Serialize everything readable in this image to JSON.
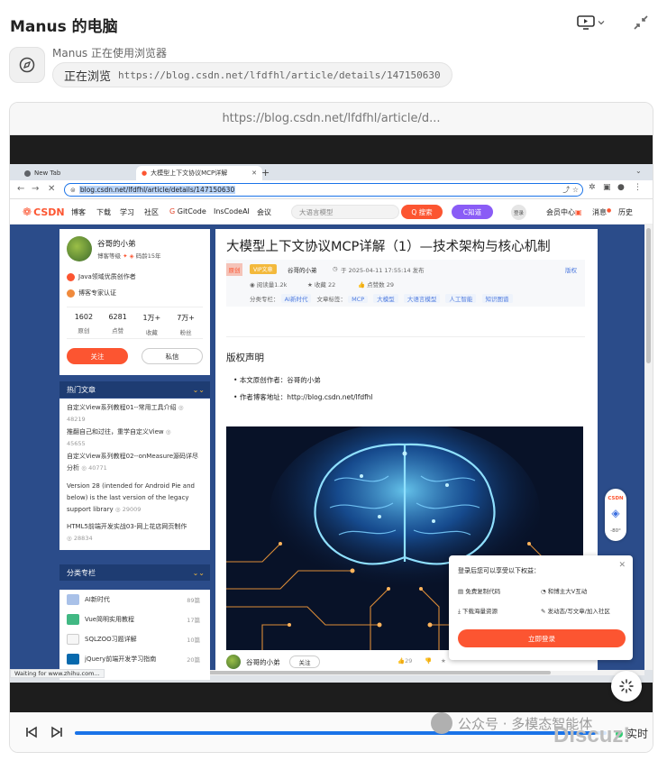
{
  "header": {
    "title": "Manus 的电脑"
  },
  "agent": {
    "status": "Manus 正在使用浏览器",
    "action_label": "正在浏览",
    "action_url": "https://blog.csdn.net/lfdfhl/article/details/147150630"
  },
  "viewer": {
    "url_display": "https://blog.csdn.net/lfdfhl/article/d..."
  },
  "browser": {
    "tabs": [
      {
        "label": "New Tab"
      },
      {
        "label": "大模型上下文协议MCP详解"
      }
    ],
    "address": "blog.csdn.net/lfdfhl/article/details/147150630",
    "status_tip": "Waiting for www.zhihu.com..."
  },
  "csdn": {
    "logo": "CSDN",
    "nav": [
      "博客",
      "下载",
      "学习",
      "社区",
      "GitCode",
      "InsCodeAI",
      "会议"
    ],
    "search_placeholder": "大语言模型",
    "search_btn": "Q 搜索",
    "cknow_btn": "C知道",
    "login": "登录",
    "right_nav": [
      "会员中心",
      "消息",
      "历史"
    ]
  },
  "profile": {
    "name": "谷哥的小弟",
    "level": "博客等级",
    "age": "码龄15年",
    "badges": [
      "Java领域优质创作者",
      "博客专家认证"
    ],
    "stats": [
      {
        "value": "1602",
        "label": "原创"
      },
      {
        "value": "6281",
        "label": "点赞"
      },
      {
        "value": "1万+",
        "label": "收藏"
      },
      {
        "value": "7万+",
        "label": "粉丝"
      }
    ],
    "follow": "关注",
    "message": "私信"
  },
  "hot": {
    "title": "热门文章",
    "items": [
      {
        "title": "自定义View系列教程01--常用工具介绍",
        "views": "48219"
      },
      {
        "title": "推翻自己和过往，重学自定义View",
        "views": "45655"
      },
      {
        "title": "自定义View系列教程02--onMeasure源码详尽分析",
        "views": "40771"
      },
      {
        "title": "Version 28 (intended for Android Pie and below) is the last version of the legacy support library",
        "views": "29009"
      },
      {
        "title": "HTML5前端开发实战03-网上花店网页制作",
        "views": "28834"
      }
    ]
  },
  "columns": {
    "title": "分类专栏",
    "items": [
      {
        "name": "AI新时代",
        "count": "89篇"
      },
      {
        "name": "Vue简明实用教程",
        "count": "17篇"
      },
      {
        "name": "SQLZOO习题详解",
        "count": "10篇"
      },
      {
        "name": "jQuery前端开发学习指南",
        "count": "20篇"
      }
    ]
  },
  "article": {
    "title": "大模型上下文协议MCP详解（1）—技术架构与核心机制",
    "orig_tag": "原创",
    "vip_tag": "VIP文章",
    "author": "谷哥的小弟",
    "date": "于 2025-04-11 17:55:14 发布",
    "collect": "版权",
    "reads": "阅读量1.2k",
    "favs": "收藏 22",
    "likes": "点赞数 29",
    "cat_label": "分类专栏：",
    "category": "AI新时代",
    "tag_label": "文章标签：",
    "tags": [
      "MCP",
      "大模型",
      "大语言模型",
      "人工智能",
      "知识图谱"
    ],
    "copyright_h": "版权声明",
    "copyright_items": [
      "本文原创作者：谷哥的小弟",
      "作者博客地址：http://blog.csdn.net/lfdfhl"
    ],
    "foot_author": "谷哥的小弟",
    "foot_follow": "关注",
    "foot_likes": "29"
  },
  "login_popup": {
    "headline": "登录后您可以享受以下权益：",
    "perks": [
      "免费复制代码",
      "和博主大V互动",
      "下载海量资源",
      "发动态/写文章/加入社区"
    ],
    "cta": "立即登录"
  },
  "float_widget": {
    "logo": "CSDN",
    "score": "-80°"
  },
  "playback": {
    "progress": 0.98,
    "live_label": "实时"
  },
  "watermark": {
    "text": "公众号 · 多模态智能体",
    "logo": "Discuz!"
  },
  "colors": {
    "csdn_orange": "#fc5531",
    "page_blue": "#2b4c8a",
    "progress_blue": "#1a73e8",
    "live_green": "#2ecc71"
  }
}
